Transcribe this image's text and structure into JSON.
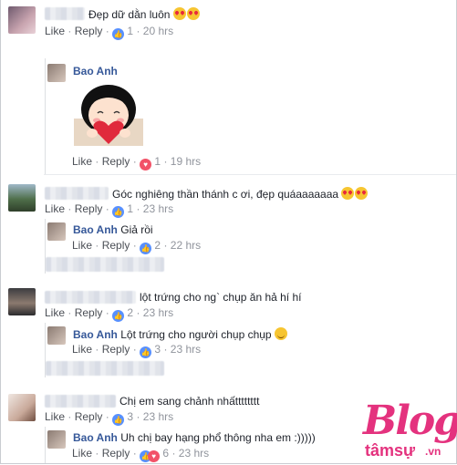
{
  "actions": {
    "like": "Like",
    "reply": "Reply",
    "dot": "·"
  },
  "c1": {
    "text": "Đẹp dữ dằn luôn",
    "count": "1",
    "time": "20 hrs"
  },
  "r1": {
    "name": "Bao Anh",
    "count": "1",
    "time": "19 hrs"
  },
  "c2": {
    "text": "Góc nghiêng thần thánh c ơi, đẹp quáaaaaaaa",
    "count": "1",
    "time": "23 hrs"
  },
  "r2": {
    "name": "Bao Anh",
    "text": "Giả rồi",
    "count": "2",
    "time": "22 hrs"
  },
  "c3": {
    "text": "lột trứng cho ng` chụp ăn hả hí hí",
    "count": "2",
    "time": "23 hrs"
  },
  "r3": {
    "name": "Bao Anh",
    "text": "Lột trứng cho người chụp chụp",
    "count": "3",
    "time": "23 hrs"
  },
  "c4": {
    "text": "Chị em sang chảnh nhấtttttttt",
    "count": "3",
    "time": "23 hrs"
  },
  "r4": {
    "name": "Bao Anh",
    "text": "Uh chị bay hạng phổ thông nha em :)))))",
    "count": "6",
    "time": "23 hrs"
  },
  "watermark": {
    "brand": "Blog",
    "sub": "tâmsự",
    "tld": ".vn"
  },
  "colors": {
    "link": "#365899",
    "meta": "#90949c",
    "like_badge": "#5890ff",
    "heart": "#f25268",
    "watermark": "#e4327e"
  },
  "icons": [
    "like-icon",
    "heart-icon",
    "heart-eyes-emoji",
    "smile-emoji",
    "avatar"
  ]
}
